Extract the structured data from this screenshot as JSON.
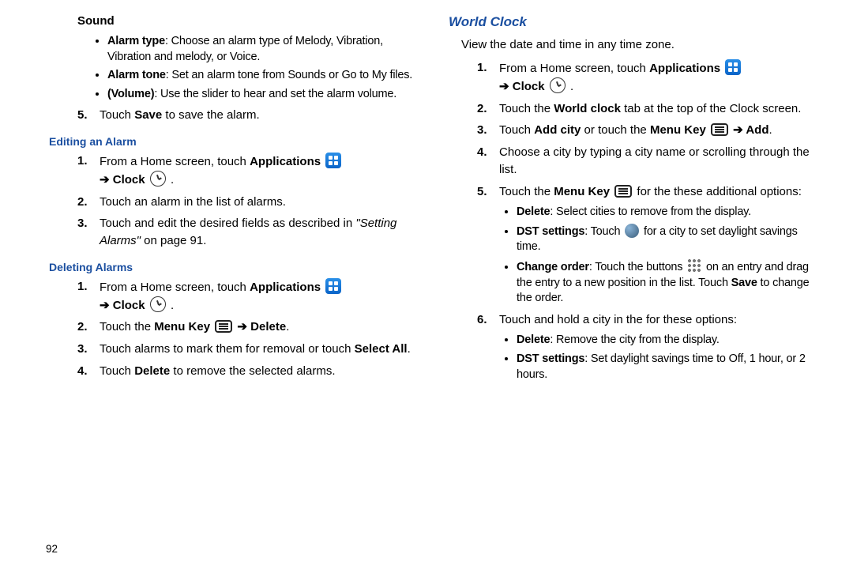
{
  "pageNumber": "92",
  "left": {
    "sound_title": "Sound",
    "sound_bullets": [
      {
        "b": "Alarm type",
        "t": ": Choose an alarm type of Melody, Vibration, Vibration and melody, or Voice."
      },
      {
        "b": "Alarm tone",
        "t": ": Set an alarm tone from Sounds or Go to My files."
      },
      {
        "b": "(Volume)",
        "t": ": Use the slider to hear and set the alarm volume."
      }
    ],
    "save_step_num": "5.",
    "save_step_pre": "Touch ",
    "save_step_b": "Save",
    "save_step_post": " to save the alarm.",
    "edit_title": "Editing an Alarm",
    "edit_steps": [
      {
        "n": "1.",
        "type": "appsclock"
      },
      {
        "n": "2.",
        "t": "Touch an alarm in the list of alarms."
      },
      {
        "n": "3.",
        "t_pre": "Touch and edit the desired fields as described in ",
        "t_it": "\"Setting Alarms\"",
        "t_post": " on page 91."
      }
    ],
    "del_title": "Deleting Alarms",
    "del_steps": [
      {
        "n": "1.",
        "type": "appsclock"
      },
      {
        "n": "2.",
        "type": "menudelete"
      },
      {
        "n": "3.",
        "t_pre": "Touch alarms to mark them for removal or touch ",
        "t_b": "Select All",
        "t_post": "."
      },
      {
        "n": "4.",
        "t_pre": "Touch ",
        "t_b": "Delete",
        "t_post": " to remove the selected alarms."
      }
    ],
    "apps_label": "Applications",
    "clock_label": "Clock",
    "menu_label": "Menu Key",
    "delete_label": "Delete",
    "touch_the": "Touch the ",
    "from_home": "From a Home screen, touch ",
    "arrow": "➔"
  },
  "right": {
    "title": "World Clock",
    "intro": "View the date and time in any time zone.",
    "steps": {
      "s1": {
        "n": "1."
      },
      "s2": {
        "n": "2.",
        "pre": "Touch the ",
        "b": "World clock",
        "post": " tab at the top of the Clock screen."
      },
      "s3": {
        "n": "3.",
        "pre": "Touch ",
        "b1": "Add city",
        "mid": " or touch the ",
        "b2": "Menu Key",
        "post_arrow": " ➔ ",
        "b3": "Add",
        "end": "."
      },
      "s4": {
        "n": "4.",
        "t": "Choose a city by typing a city name or scrolling through the list."
      },
      "s5": {
        "n": "5.",
        "pre": "Touch the ",
        "b": "Menu Key",
        "post": " for the these additional options:"
      },
      "s6": {
        "n": "6.",
        "t": "Touch and hold a city in the for these options:"
      }
    },
    "opts1": [
      {
        "b": "Delete",
        "t": ": Select cities to remove from the display."
      },
      {
        "b": "DST settings",
        "t": ": Touch ",
        "icon": "globe",
        "t2": " for a city to set daylight savings time."
      },
      {
        "b": "Change order",
        "t": ": Touch the buttons ",
        "icon": "dots",
        "t2": " on an entry and drag the entry to a new position in the list. Touch ",
        "b2": "Save",
        "t3": " to change the order."
      }
    ],
    "opts2": [
      {
        "b": "Delete",
        "t": ": Remove the city from the display."
      },
      {
        "b": "DST settings",
        "t": ": Set daylight savings time to Off, 1 hour, or 2 hours."
      }
    ],
    "apps_label": "Applications",
    "clock_label": "Clock",
    "from_home": "From a Home screen, touch ",
    "arrow": "➔"
  }
}
